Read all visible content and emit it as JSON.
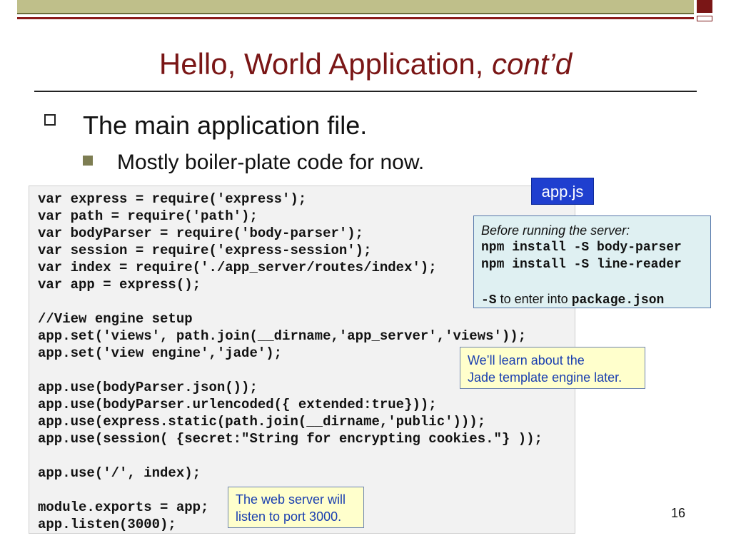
{
  "title": {
    "main": "Hello, World Application, ",
    "emph": "cont’d"
  },
  "bullets": {
    "level1": "The main application file.",
    "level2": "Mostly boiler-plate code for now."
  },
  "code_lines": [
    "var express = require('express');",
    "var path = require('path');",
    "var bodyParser = require('body-parser');",
    "var session = require('express-session');",
    "var index = require('./app_server/routes/index');",
    "var app = express();",
    "",
    "//View engine setup",
    "app.set('views', path.join(__dirname,'app_server','views'));",
    "app.set('view engine','jade');",
    "",
    "app.use(bodyParser.json());",
    "app.use(bodyParser.urlencoded({ extended:true}));",
    "app.use(express.static(path.join(__dirname,'public')));",
    "app.use(session( {secret:\"String for encrypting cookies.\"} ));",
    "",
    "app.use('/', index);",
    "",
    "module.exports = app;",
    "app.listen(3000);"
  ],
  "file_label": "app.js",
  "note_install": {
    "intro": "Before running the server:",
    "cmd1": "npm install -S body-parser",
    "cmd2": "npm install -S line-reader",
    "flag": "-S",
    "flag_desc": " to enter into ",
    "file": "package.json"
  },
  "note_jade": {
    "line1": "We’ll learn about the",
    "line2": "Jade template engine later."
  },
  "note_port": {
    "line1": "The web server will",
    "line2": "listen to port 3000."
  },
  "page_number": "16",
  "colors": {
    "title": "#7a1616",
    "accent_bar": "#8b1a1a",
    "olive_bar": "#bfbf8a",
    "file_label_bg": "#1f3fcf",
    "note_blue_bg": "#dff0f2",
    "note_yellow_bg": "#ffffcc",
    "note_text_blue": "#1a3fb0"
  }
}
